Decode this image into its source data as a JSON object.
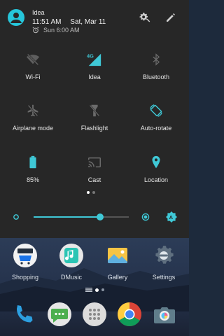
{
  "header": {
    "carrier": "Idea",
    "time": "11:51 AM",
    "date": "Sat, Mar 11",
    "alarm": "Sun 6:00 AM",
    "avatar_icon": "account-circle-icon",
    "settings_icon": "gear-wrench-icon",
    "edit_icon": "pencil-icon"
  },
  "tiles": [
    {
      "label": "Wi-Fi",
      "icon": "wifi-off-icon",
      "active": false
    },
    {
      "label": "Idea",
      "icon": "cellular-4g-icon",
      "active": true
    },
    {
      "label": "Bluetooth",
      "icon": "bluetooth-icon",
      "active": false
    },
    {
      "label": "Airplane mode",
      "icon": "airplane-icon",
      "active": false
    },
    {
      "label": "Flashlight",
      "icon": "flashlight-icon",
      "active": false
    },
    {
      "label": "Auto-rotate",
      "icon": "auto-rotate-icon",
      "active": true
    },
    {
      "label": "85%",
      "icon": "battery-icon",
      "active": true
    },
    {
      "label": "Cast",
      "icon": "cast-icon",
      "active": false
    },
    {
      "label": "Location",
      "icon": "location-pin-icon",
      "active": true
    }
  ],
  "brightness": {
    "level": 0.7,
    "auto": true
  },
  "colors": {
    "accent": "#3fc8d6",
    "shade_bg": "#272727",
    "inactive_icon": "#6b6b6b"
  },
  "home_apps": [
    {
      "label": "Shopping",
      "icon": "amazon-shopping-icon"
    },
    {
      "label": "DMusic",
      "icon": "jiosaavn-icon"
    },
    {
      "label": "Gallery",
      "icon": "gallery-icon"
    },
    {
      "label": "Settings",
      "icon": "settings-icon"
    }
  ],
  "dock": [
    {
      "icon": "phone-icon"
    },
    {
      "icon": "messages-icon"
    },
    {
      "icon": "app-drawer-icon"
    },
    {
      "icon": "chrome-icon"
    },
    {
      "icon": "camera-icon"
    }
  ]
}
